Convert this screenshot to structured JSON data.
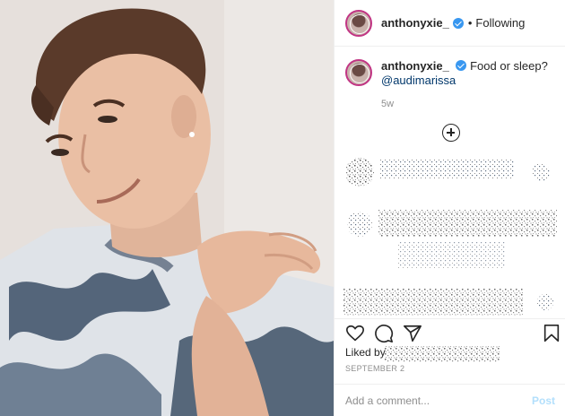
{
  "post": {
    "username": "anthonyxie_",
    "separator": "•",
    "follow_status": "Following",
    "caption_text": "Food or sleep?",
    "caption_mention": "@audimarissa",
    "age": "5w"
  },
  "footer": {
    "liked_by_label": "Liked by",
    "date": "SEPTEMBER 2",
    "comment_placeholder": "Add a comment...",
    "post_label": "Post"
  },
  "colors": {
    "verified_badge": "#3897f0",
    "mention": "#00376b",
    "post_button_disabled": "#b2dffc",
    "avatar_ring": "#c13584"
  },
  "icons": [
    "verified-icon",
    "add-circle-icon",
    "heart-icon",
    "comment-icon",
    "share-icon",
    "bookmark-icon"
  ]
}
